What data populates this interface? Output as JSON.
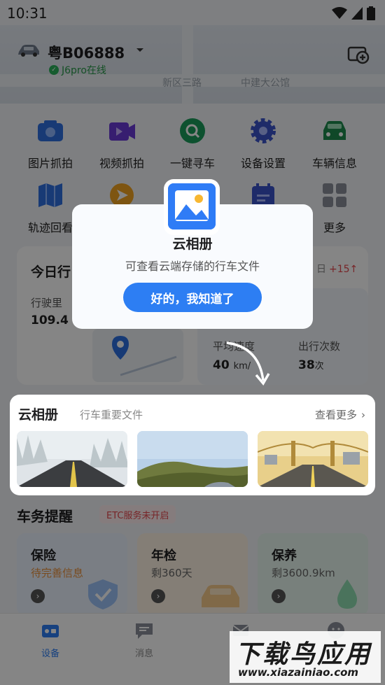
{
  "status_bar": {
    "time": "10:31"
  },
  "header": {
    "plate": "粤B06888",
    "status": "J6pro在线",
    "map_labels": [
      "新区三路",
      "中建大公馆"
    ]
  },
  "quick_actions": [
    {
      "label": "图片抓拍",
      "icon": "camera-icon"
    },
    {
      "label": "视频抓拍",
      "icon": "video-icon"
    },
    {
      "label": "一键寻车",
      "icon": "find-car-icon"
    },
    {
      "label": "设备设置",
      "icon": "gear-icon"
    },
    {
      "label": "车辆信息",
      "icon": "car-icon"
    },
    {
      "label": "轨迹回看",
      "icon": "map-icon"
    },
    {
      "label": "",
      "icon": "navigate-icon"
    },
    {
      "label": "",
      "icon": "album-icon"
    },
    {
      "label": "",
      "icon": "calendar-icon"
    },
    {
      "label": "更多",
      "icon": "more-grid-icon"
    }
  ],
  "today": {
    "title": "今日行",
    "badge_text": "日",
    "badge_delta": "+15",
    "mileage_label": "行驶里",
    "mileage_value": "109.4",
    "avg_speed_label": "平均速度",
    "avg_speed_value": "40",
    "avg_speed_unit": "km/",
    "trips_label": "出行次数",
    "trips_value": "38",
    "trips_unit": "次"
  },
  "popup": {
    "title": "云相册",
    "description": "可查看云端存储的行车文件",
    "confirm_label": "好的，我知道了"
  },
  "album": {
    "title": "云相册",
    "subtitle": "行车重要文件",
    "more_label": "查看更多"
  },
  "reminders": {
    "title": "车务提醒",
    "etc_badge": "ETC服务未开启",
    "cards": [
      {
        "title": "保险",
        "subtitle": "待完善信息",
        "subtitle_color": "#e8913a"
      },
      {
        "title": "年检",
        "subtitle": "剩360天",
        "subtitle_color": "#666666"
      },
      {
        "title": "保养",
        "subtitle": "剩3600.9km",
        "subtitle_color": "#666666"
      }
    ]
  },
  "tabs": [
    {
      "label": "设备",
      "active": true
    },
    {
      "label": "消息",
      "active": false
    },
    {
      "label": "",
      "active": false
    },
    {
      "label": "",
      "active": false
    }
  ],
  "watermark": {
    "big": "下载鸟应用",
    "small": "www.xiazainiao.com"
  },
  "colors": {
    "primary": "#2d7ef3",
    "online": "#2a9a4a",
    "alert": "#e5484d"
  }
}
